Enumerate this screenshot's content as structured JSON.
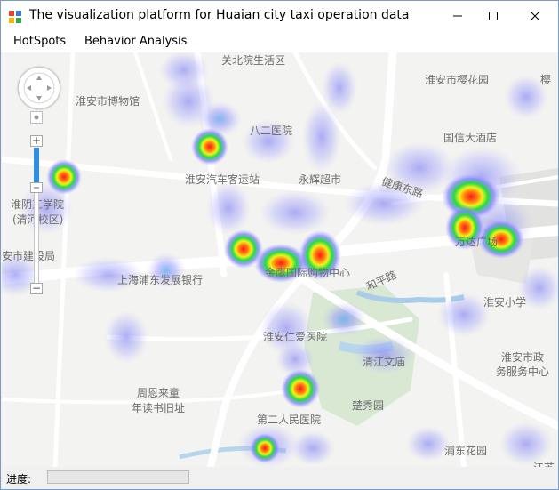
{
  "window": {
    "title": "The visualization platform for Huaian city taxi operation data",
    "minimize_icon": "minimize-icon",
    "maximize_icon": "maximize-icon",
    "close_icon": "close-icon",
    "app_icon": "app-icon"
  },
  "menu": {
    "items": [
      {
        "label": "HotSpots"
      },
      {
        "label": "Behavior Analysis"
      }
    ]
  },
  "map": {
    "labels": [
      "关北院生活区",
      "淮安市樱花园",
      "淮安市博物馆",
      "八二医院",
      "国信大酒店",
      "淮安汽车客运站",
      "永辉超市",
      "健康东路",
      "淮阴工学院",
      "(清河校区)",
      "安市建设局",
      "上海浦东发展银行",
      "金鹰国际购物中心",
      "万达广场",
      "和平路",
      "淮安小学",
      "淮安仁爱医院",
      "清江文庙",
      "淮安市政",
      "务服务中心",
      "周恩来童",
      "年读书旧址",
      "楚秀园",
      "第二人民医院",
      "浦东花园",
      "江苏",
      "樱"
    ],
    "controls": {
      "pan_icon": "pan-compass-icon",
      "zoom_in": "+",
      "zoom_out": "−",
      "zoom_level_fraction": 0.28
    }
  },
  "status": {
    "label": "进度:",
    "progress": 0
  },
  "colors": {
    "map_background": "#f3f3f1",
    "road": "#ffffff",
    "water": "#a9cde8",
    "park": "#d6e6d0",
    "heat_outer": "#7b7bff",
    "heat_mid": "#22dd44",
    "heat_core": "#ff1d1d",
    "progress": "#06b025"
  }
}
